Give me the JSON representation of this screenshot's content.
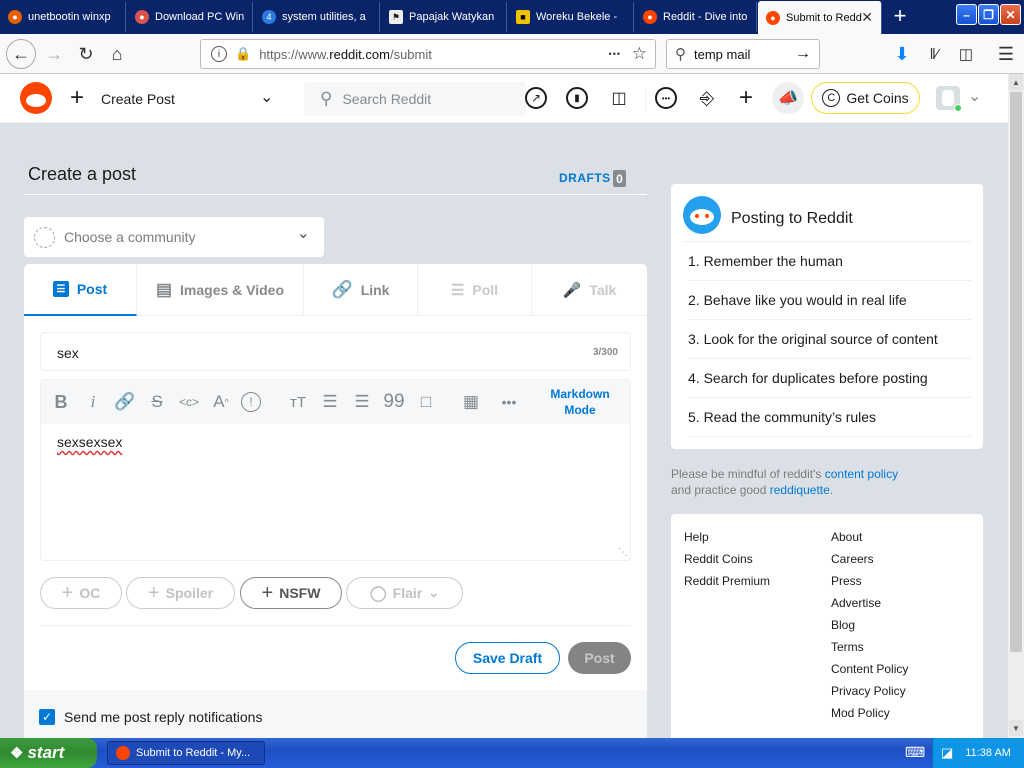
{
  "browser": {
    "tabs": [
      {
        "label": "unetbootin winxp",
        "color": "#e66000"
      },
      {
        "label": "Download PC Win",
        "color": "#d9534f"
      },
      {
        "label": "system utilities, a",
        "color": "#2a7ae2"
      },
      {
        "label": "Papajak Watykan",
        "color": "#222222"
      },
      {
        "label": "Woreku Bekele - ",
        "color": "#f2c200"
      },
      {
        "label": "Reddit - Dive into",
        "color": "#ff4500"
      },
      {
        "label": "Submit to Redd",
        "color": "#ff4500"
      }
    ],
    "new_tab": "+",
    "url_prefix": "https://www.",
    "url_domain": "reddit.com",
    "url_path": "/submit",
    "url_more": "•••",
    "search_value": "temp mail"
  },
  "reddit_header": {
    "create_post": "Create Post",
    "search_placeholder": "Search Reddit",
    "get_coins": "Get Coins"
  },
  "page": {
    "title": "Create a post",
    "drafts_label": "DRAFTS",
    "drafts_count": "0",
    "community_placeholder": "Choose a community",
    "tabs": [
      {
        "label": "Post",
        "active": true
      },
      {
        "label": "Images & Video"
      },
      {
        "label": "Link"
      },
      {
        "label": "Poll"
      },
      {
        "label": "Talk"
      }
    ],
    "title_value": "sex",
    "title_counter": "3/300",
    "markdown_line1": "Markdown",
    "markdown_line2": "Mode",
    "body_value": "sexsexsex",
    "tags": {
      "oc": "OC",
      "spoiler": "Spoiler",
      "nsfw": "NSFW",
      "flair": "Flair"
    },
    "save_draft": "Save Draft",
    "post": "Post",
    "notify_label": "Send me post reply notifications",
    "notify_checked": true
  },
  "sidebar": {
    "posting_title": "Posting to Reddit",
    "rules": [
      "1. Remember the human",
      "2. Behave like you would in real life",
      "3. Look for the original source of content",
      "4. Search for duplicates before posting",
      "5. Read the community’s rules"
    ],
    "mindful_text1": "Please be mindful of reddit's ",
    "content_policy_link": "content policy",
    "mindful_text2": "and practice good ",
    "reddiquette_link": "reddiquette",
    "mindful_end": ".",
    "footer_left": [
      "Help",
      "Reddit Coins",
      "Reddit Premium"
    ],
    "footer_right": [
      "About",
      "Careers",
      "Press",
      "Advertise",
      "Blog",
      "Terms",
      "Content Policy",
      "Privacy Policy",
      "Mod Policy"
    ]
  },
  "taskbar": {
    "start": "start",
    "window_label": "Submit to Reddit - My...",
    "clock": "11:38 AM"
  },
  "colors": {
    "reddit_orange": "#ff4500",
    "reddit_blue": "#0079d3",
    "link_blue": "#0079d3",
    "xp_blue": "#245dda",
    "xp_green": "#3c9a3c"
  }
}
